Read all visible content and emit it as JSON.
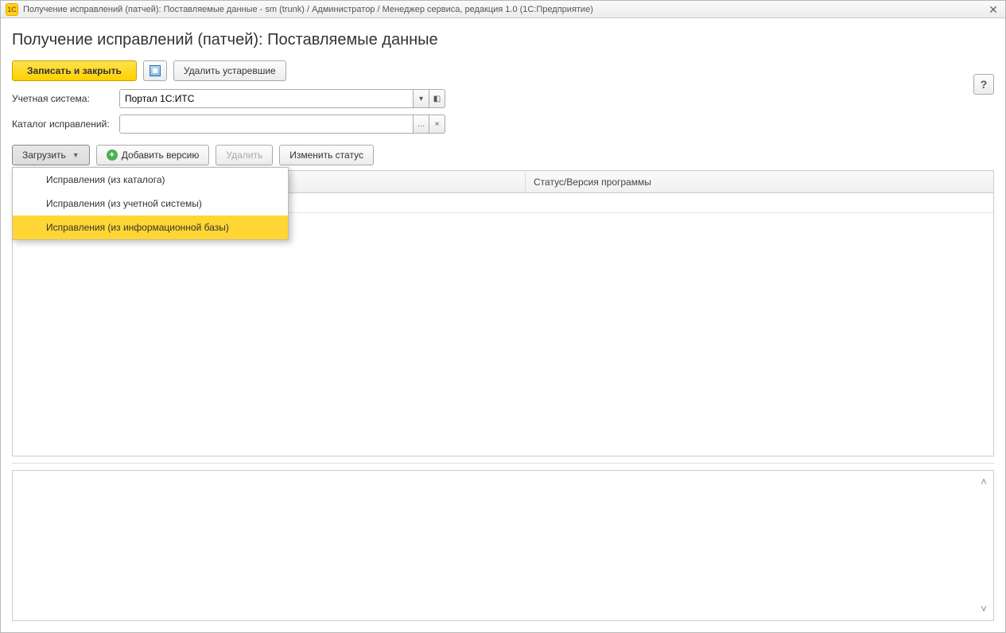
{
  "window": {
    "logo_text": "1C",
    "title": "Получение исправлений (патчей): Поставляемые данные - sm (trunk) / Администратор / Менеджер сервиса, редакция 1.0  (1С:Предприятие)"
  },
  "page": {
    "title": "Получение исправлений (патчей): Поставляемые данные"
  },
  "toolbar": {
    "save_and_close": "Записать и закрыть",
    "delete_obsolete": "Удалить устаревшие",
    "help": "?"
  },
  "form": {
    "account_system_label": "Учетная система:",
    "account_system_value": "Портал 1С:ИТС",
    "patch_dir_label": "Каталог исправлений:",
    "patch_dir_value": ""
  },
  "sub_toolbar": {
    "load": "Загрузить",
    "add_version": "Добавить версию",
    "delete": "Удалить",
    "change_status": "Изменить статус"
  },
  "dropdown": {
    "item1": "Исправления (из каталога)",
    "item2": "Исправления (из учетной системы)",
    "item3": "Исправления (из информационной базы)"
  },
  "grid": {
    "col1": "",
    "col2": "Статус/Версия программы"
  }
}
